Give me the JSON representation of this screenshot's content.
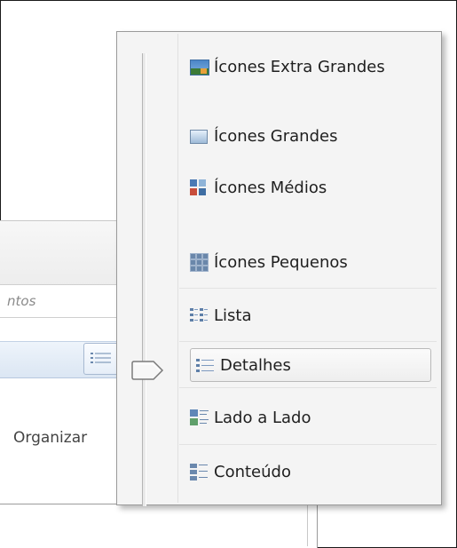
{
  "background": {
    "search_placeholder": "ntos",
    "organize_label": "Organizar"
  },
  "menu": {
    "items": [
      {
        "label": "Ícones Extra Grandes",
        "icon": "extra-large-icons-icon"
      },
      {
        "label": "Ícones Grandes",
        "icon": "large-icons-icon"
      },
      {
        "label": "Ícones Médios",
        "icon": "medium-icons-icon"
      },
      {
        "label": "Ícones Pequenos",
        "icon": "small-icons-icon"
      },
      {
        "label": "Lista",
        "icon": "list-icon"
      },
      {
        "label": "Detalhes",
        "icon": "details-icon",
        "selected": true
      },
      {
        "label": "Lado a Lado",
        "icon": "tiles-icon"
      },
      {
        "label": "Conteúdo",
        "icon": "content-icon"
      }
    ]
  },
  "colors": {
    "menu_bg": "#f4f4f4",
    "selection_border": "#b9b9b9",
    "text": "#1f1f1f"
  }
}
